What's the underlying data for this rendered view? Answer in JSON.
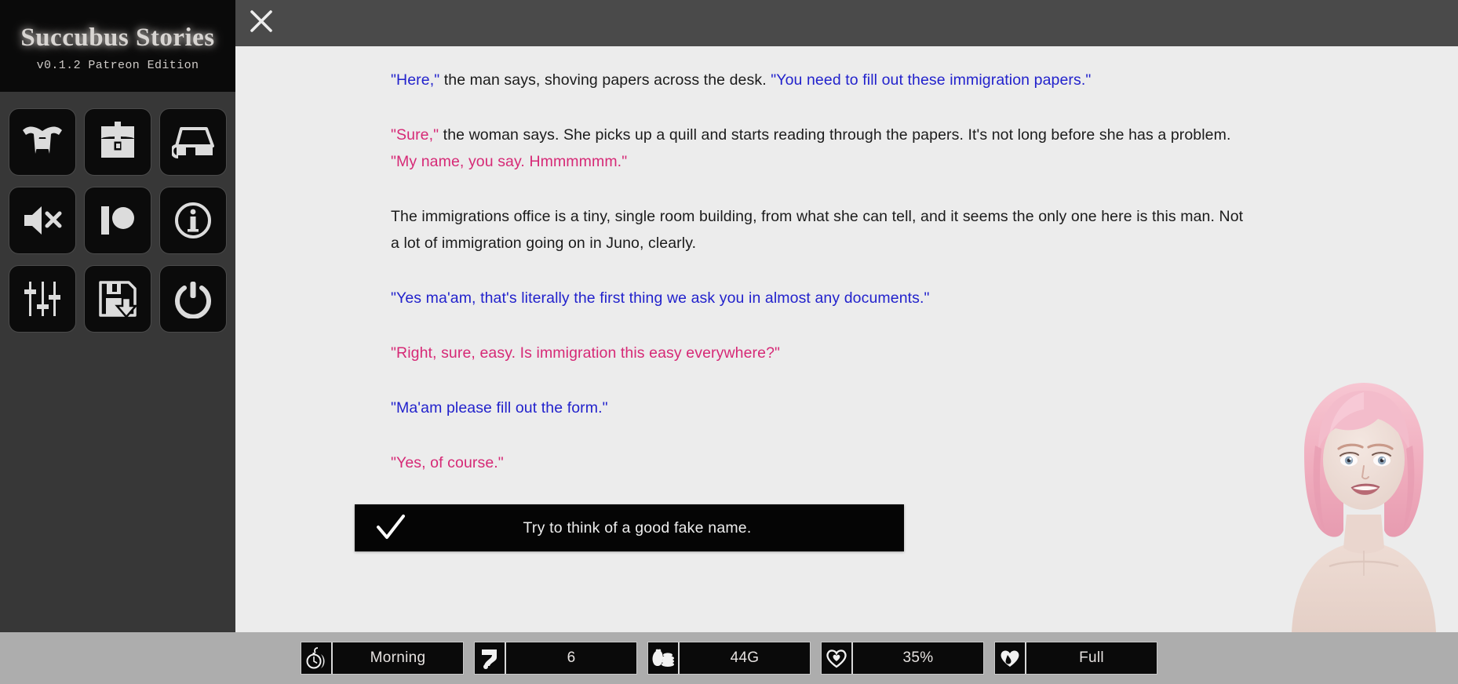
{
  "window": {
    "title": "Succubus Stories",
    "version": "v0.1.2 Patreon Edition"
  },
  "topbar": {
    "close_label": "×",
    "close_icon": "close-icon"
  },
  "sidebar": {
    "buttons": [
      {
        "id": "fangs",
        "icon": "fangs-icon",
        "label": "Fangs / Character"
      },
      {
        "id": "backpack",
        "icon": "backpack-icon",
        "label": "Inventory"
      },
      {
        "id": "bed",
        "icon": "bed-icon",
        "label": "Rest"
      },
      {
        "id": "mute",
        "icon": "speaker-mute-icon",
        "label": "Mute Audio"
      },
      {
        "id": "patreon",
        "icon": "patreon-icon",
        "label": "Patreon"
      },
      {
        "id": "info",
        "icon": "info-icon",
        "label": "Information"
      },
      {
        "id": "settings",
        "icon": "sliders-icon",
        "label": "Settings"
      },
      {
        "id": "save",
        "icon": "floppy-save-icon",
        "label": "Save / Load"
      },
      {
        "id": "quit",
        "icon": "power-icon",
        "label": "Quit"
      }
    ]
  },
  "story": {
    "paragraphs": [
      {
        "id": "p1",
        "runs": [
          {
            "text": "\"Here,\"",
            "style": "blue"
          },
          {
            "text": " the man says, shoving papers across the desk. ",
            "style": "plain"
          },
          {
            "text": "\"You need to fill out these immigration papers.\"",
            "style": "blue"
          }
        ]
      },
      {
        "id": "p2",
        "runs": [
          {
            "text": "\"Sure,\"",
            "style": "pink"
          },
          {
            "text": " the woman says. She picks up a quill and starts reading through the papers. It's not long before she has a problem. ",
            "style": "plain"
          },
          {
            "text": "\"My name, you say. Hmmmmmm.\"",
            "style": "pink"
          }
        ]
      },
      {
        "id": "p3",
        "runs": [
          {
            "text": "The immigrations office is a tiny, single room building, from what she can tell, and it seems the only one here is this man. Not a lot of immigration going on in Juno, clearly.",
            "style": "plain"
          }
        ]
      },
      {
        "id": "p4",
        "runs": [
          {
            "text": "\"Yes ma'am, that's literally the first thing we ask you in almost any documents.\"",
            "style": "blue"
          }
        ]
      },
      {
        "id": "p5",
        "runs": [
          {
            "text": "\"Right, sure, easy. Is immigration this easy everywhere?\"",
            "style": "pink"
          }
        ]
      },
      {
        "id": "p6",
        "runs": [
          {
            "text": "\"Ma'am please fill out the form.\"",
            "style": "blue"
          }
        ]
      },
      {
        "id": "p7",
        "runs": [
          {
            "text": "\"Yes, of course.\"",
            "style": "pink"
          }
        ]
      }
    ]
  },
  "choices": [
    {
      "id": "choice-fake-name",
      "icon": "checkmark-icon",
      "label": "Try to think of a good fake name."
    }
  ],
  "status_bar": [
    {
      "id": "time",
      "icon": "pocket-watch-icon",
      "value": "Morning"
    },
    {
      "id": "day",
      "icon": "hand-day-icon",
      "value": "6"
    },
    {
      "id": "money",
      "icon": "money-bag-icon",
      "value": "44G"
    },
    {
      "id": "health",
      "icon": "heart-outline-icon",
      "value": "35%"
    },
    {
      "id": "blood",
      "icon": "heart-drop-icon",
      "value": "Full"
    }
  ],
  "colors": {
    "dialogue_blue": "#2222cc",
    "dialogue_pink": "#d62976",
    "body_text": "#1b1b1b",
    "sidebar_bg": "#373737",
    "sidebar_header_bg": "#0a0a0a",
    "topbar_bg": "#4a4a4a",
    "content_bg": "#ececec",
    "statusbar_bg": "#adadad",
    "stat_chip_bg": "#0a0a0a",
    "choice_bg": "#050505",
    "hair": "#f0b8c4"
  },
  "portrait": {
    "name": "female-character-portrait",
    "description": "pink bob hair character"
  }
}
